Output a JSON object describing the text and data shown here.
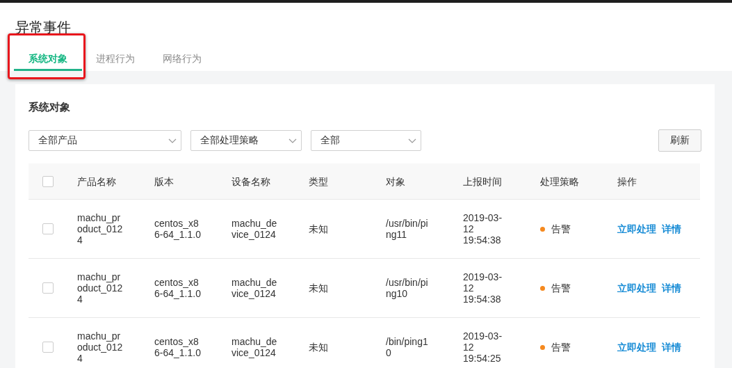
{
  "page": {
    "title": "异常事件"
  },
  "tabs": [
    {
      "label": "系统对象",
      "selected": true,
      "highlighted": true
    },
    {
      "label": "进程行为",
      "selected": false,
      "highlighted": false
    },
    {
      "label": "网络行为",
      "selected": false,
      "highlighted": false
    }
  ],
  "card": {
    "title": "系统对象",
    "filters": [
      {
        "value": "全部产品"
      },
      {
        "value": "全部处理策略"
      },
      {
        "value": "全部"
      }
    ],
    "refresh_button": "刷新",
    "table": {
      "select_all_checked": false,
      "columns": [
        "产品名称",
        "版本",
        "设备名称",
        "类型",
        "对象",
        "上报时间",
        "处理策略",
        "操作"
      ],
      "rows": [
        {
          "checked": false,
          "product": "machu_product_0124",
          "version": "centos_x86-64_1.1.0",
          "device": "machu_device_0124",
          "type": "未知",
          "object": "/usr/bin/ping11",
          "time": "2019-03-12 19:54:38",
          "policy": {
            "label": "告警",
            "color": "#f5891f"
          },
          "actions": [
            "立即处理",
            "详情"
          ]
        },
        {
          "checked": false,
          "product": "machu_product_0124",
          "version": "centos_x86-64_1.1.0",
          "device": "machu_device_0124",
          "type": "未知",
          "object": "/usr/bin/ping10",
          "time": "2019-03-12 19:54:38",
          "policy": {
            "label": "告警",
            "color": "#f5891f"
          },
          "actions": [
            "立即处理",
            "详情"
          ]
        },
        {
          "checked": false,
          "product": "machu_product_0124",
          "version": "centos_x86-64_1.1.0",
          "device": "machu_device_0124",
          "type": "未知",
          "object": "/bin/ping10",
          "time": "2019-03-12 19:54:25",
          "policy": {
            "label": "告警",
            "color": "#f5891f"
          },
          "actions": [
            "立即处理",
            "详情"
          ]
        }
      ]
    }
  }
}
